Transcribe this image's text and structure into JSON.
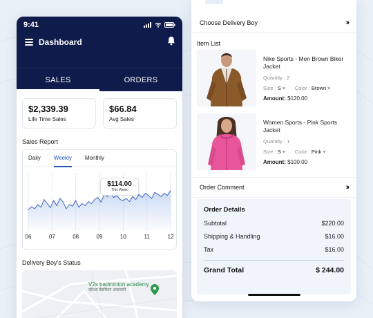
{
  "colors": {
    "brand_dark": "#0f1b4a",
    "accent": "#2255b8",
    "background": "#e9f0f8",
    "map_pin": "#2a9a4e"
  },
  "left": {
    "status_time": "9:41",
    "title": "Dashboard",
    "tabs": [
      {
        "label": "SALES",
        "active": true
      },
      {
        "label": "ORDERS",
        "active": false
      }
    ],
    "stats": [
      {
        "value": "$2,339.39",
        "label": "Life Time Sales"
      },
      {
        "value": "$66.84",
        "label": "Avg Sales"
      }
    ],
    "sales_report_title": "Sales Report",
    "report_tabs": [
      {
        "label": "Daily"
      },
      {
        "label": "Weekly",
        "active": true
      },
      {
        "label": "Monthly"
      }
    ],
    "tooltip": {
      "value": "$114.00",
      "label": "This Week"
    },
    "delivery_status_title": "Delivery Boy's Status",
    "map": {
      "place_name": "V2s badminton academy",
      "place_name_local": "व्ही२स बैडमिंटन अकादमी"
    },
    "icons": {
      "menu": "hamburger-icon",
      "notifications": "bell-icon",
      "map_marker": "map-pin-icon"
    }
  },
  "chart_data": {
    "type": "area",
    "x_ticks": [
      "06",
      "07",
      "08",
      "09",
      "10",
      "11",
      "12"
    ],
    "values": [
      40,
      46,
      42,
      50,
      45,
      60,
      52,
      44,
      58,
      48,
      62,
      55,
      42,
      50,
      47,
      58,
      45,
      52,
      48,
      56,
      52,
      60,
      64,
      55,
      70,
      66,
      72,
      64,
      68,
      60,
      58,
      62,
      56,
      66,
      60,
      70,
      64,
      72,
      68,
      62,
      74,
      70,
      66,
      72,
      68,
      78
    ],
    "ylim": [
      0,
      100
    ],
    "grid": "vertical dashed",
    "highlight": {
      "value": "$114.00",
      "label": "This Week"
    }
  },
  "right": {
    "choose_delivery_label": "Choose Delivery Boy",
    "item_list_title": "Item List",
    "items": [
      {
        "name": "Nike Sports - Men Brown Biker Jacket",
        "quantity": "Quantity : 2",
        "size_label": "Size :",
        "size_value": "S",
        "color_label": "Color :",
        "color_value": "Brown",
        "amount_label": "Amount:",
        "amount_value": "$120.00",
        "image": "brown-jacket-man"
      },
      {
        "name": "Women Sports - Pink Sports Jacket",
        "quantity": "Quantity : 1",
        "size_label": "Size :",
        "size_value": "S",
        "color_label": "Color :",
        "color_value": "Pink",
        "amount_label": "Amount:",
        "amount_value": "$100.00",
        "image": "pink-jacket-woman"
      }
    ],
    "order_comment_label": "Order Comment",
    "order_details": {
      "title": "Order Details",
      "rows": [
        {
          "label": "Subtotal",
          "value": "$220.00"
        },
        {
          "label": "Shipping & Handling",
          "value": "$16.00"
        },
        {
          "label": "Tax",
          "value": "$16.00"
        }
      ],
      "grand_total_label": "Grand Total",
      "grand_total_value": "$ 244.00"
    },
    "icons": {
      "chevron": "double-chevron-right-icon",
      "dropdown": "caret-down-icon"
    }
  }
}
